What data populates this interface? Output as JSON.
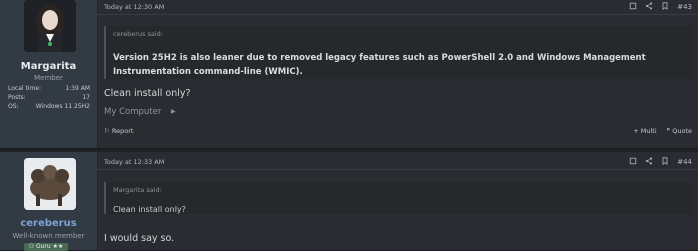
{
  "posts": [
    {
      "username": "Margarita",
      "user_title": "Member",
      "info": [
        {
          "label": "Local time:",
          "value": "1:39 AM"
        },
        {
          "label": "Posts:",
          "value": "17"
        },
        {
          "label": "OS:",
          "value": "Windows 11 25H2"
        }
      ],
      "date": "Today at 12:30 AM",
      "post_number": "#43",
      "quote_attribution": "cereberus said:",
      "quote_text": "Version 25H2 is also leaner due to removed legacy features such as PowerShell 2.0 and Windows Management Instrumentation command-line (WMIC).",
      "body": "Clean install only?",
      "my_computer": "My Computer",
      "report": "Report",
      "multi": "+ Multi",
      "quote_btn": "Quote"
    },
    {
      "username": "cereberus",
      "user_title": "Well-known member",
      "badge": "Guru",
      "date": "Today at 12:33 AM",
      "post_number": "#44",
      "quote_attribution": "Margarita said:",
      "quote_text": "Clean install only?",
      "body": "I would say so."
    }
  ],
  "colors": {
    "accent_blue": "#7ca3d6",
    "background": "#2a2c31",
    "sidebar": "#323a44"
  },
  "icons": [
    "bookmark-square-icon",
    "share-icon",
    "bookmark-icon",
    "quote-icon",
    "flag-icon",
    "chevron-right-icon",
    "user-icon",
    "star-icon"
  ]
}
